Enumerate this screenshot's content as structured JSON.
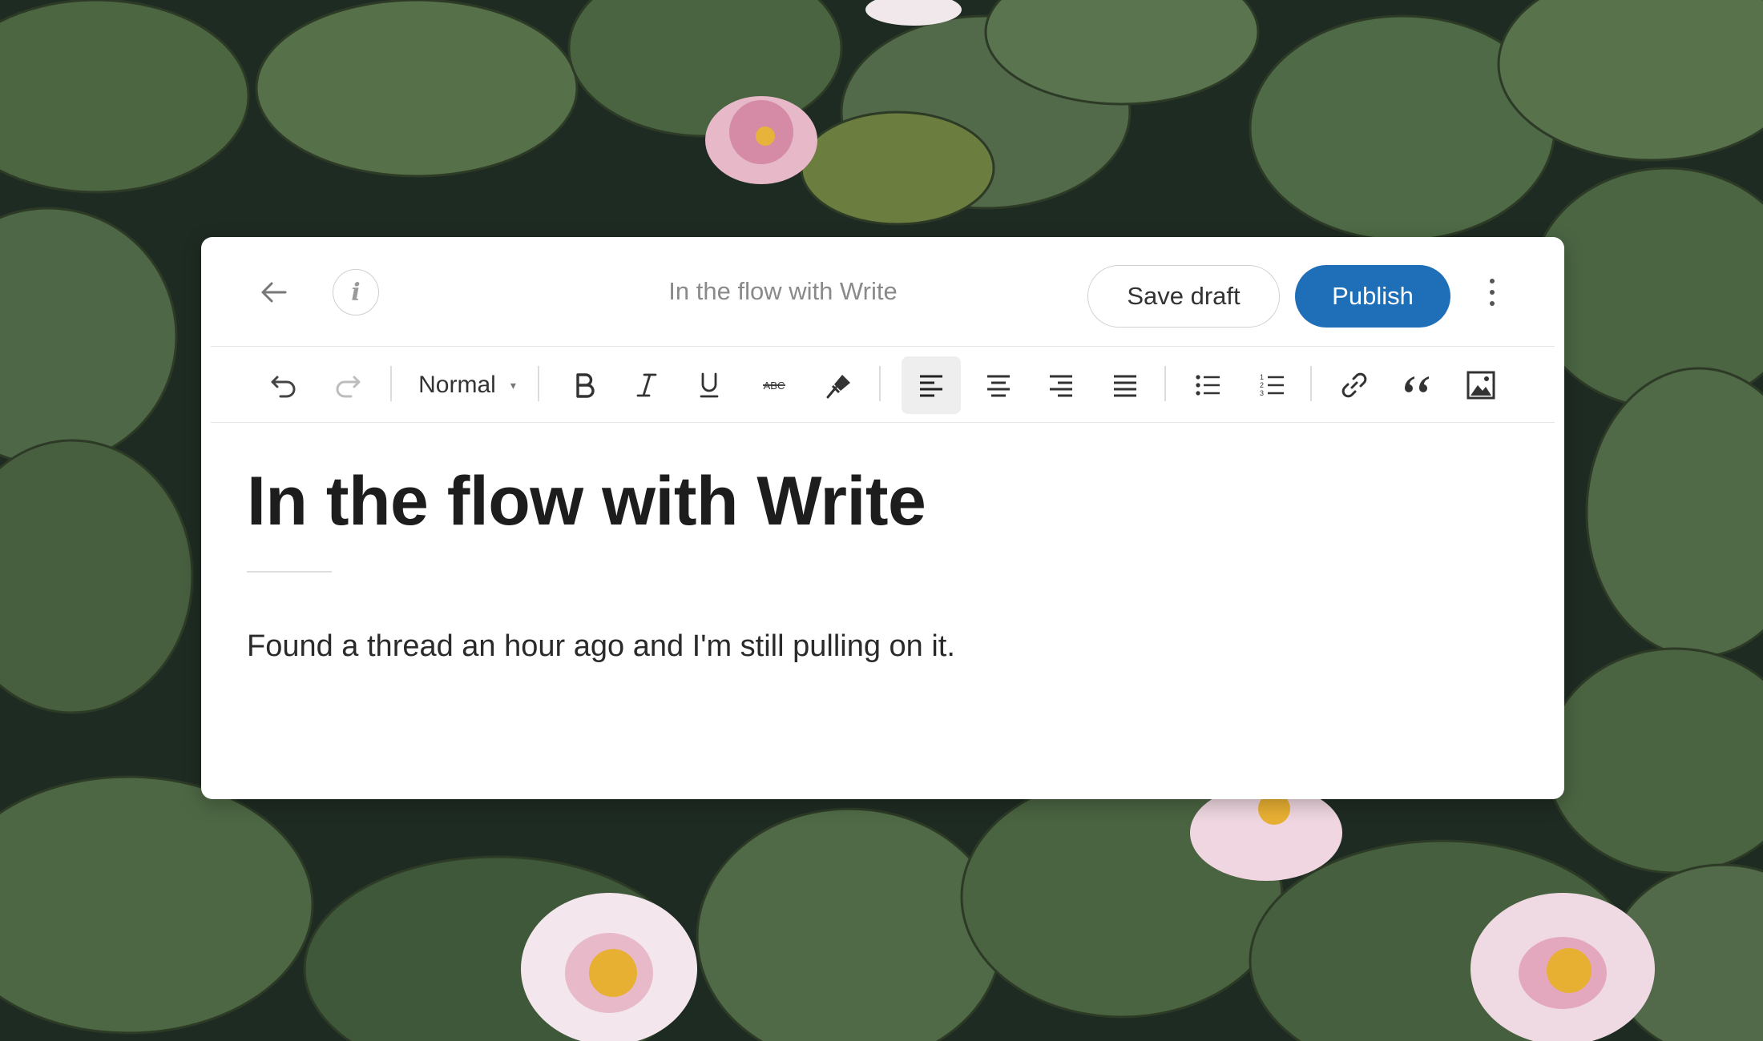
{
  "header": {
    "document_title": "In the flow with Write",
    "save_draft_label": "Save draft",
    "publish_label": "Publish",
    "info_glyph": "i",
    "colors": {
      "publish": "#1f6fb8"
    }
  },
  "toolbar": {
    "paragraph_style": "Normal",
    "active_alignment": "align-left",
    "icons": [
      "undo-icon",
      "redo-icon",
      "bold-icon",
      "italic-icon",
      "underline-icon",
      "strikethrough-icon",
      "clear-formatting-icon",
      "align-left-icon",
      "align-center-icon",
      "align-right-icon",
      "justify-icon",
      "bullet-list-icon",
      "numbered-list-icon",
      "link-icon",
      "quote-icon",
      "image-icon"
    ]
  },
  "post": {
    "title": "In the flow with Write",
    "body": "Found a thread an hour ago and I'm still pulling on it."
  }
}
